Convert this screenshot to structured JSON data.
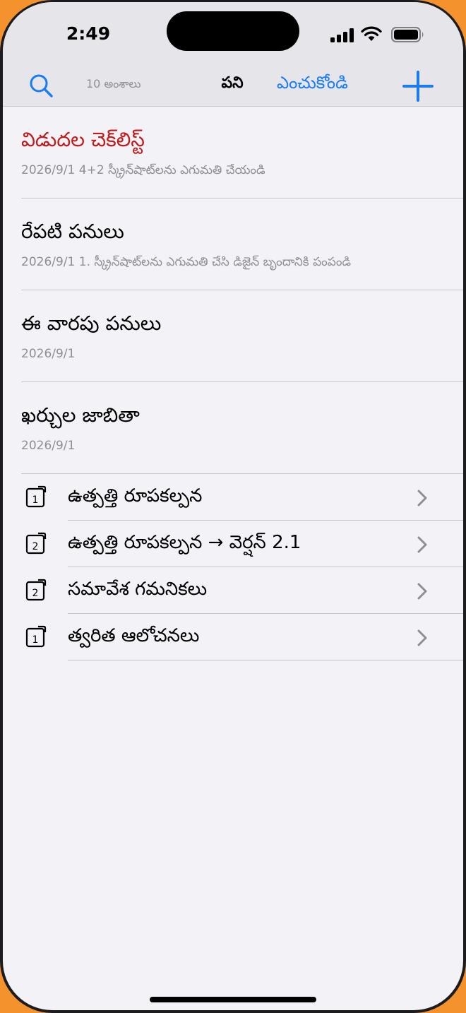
{
  "status_bar": {
    "time": "2:49"
  },
  "nav": {
    "item_count": "10 అంశాలు",
    "title": "పని",
    "select_label": "ఎంచుకోండి"
  },
  "notes": [
    {
      "title": "విడుదల చెక్‌లిస్ట్",
      "meta": "2026/9/1  4+2 స్క్రీన్‌షాట్‌లను ఎగుమతి చేయండి",
      "title_color": "#c11a1a"
    },
    {
      "title": "రేపటి పనులు",
      "meta": "2026/9/1  1. స్క్రీన్‌షాట్‌లను ఎగుమతి చేసి డిజైన్ బృందానికి పంపండి"
    },
    {
      "title": "ఈ వారపు పనులు",
      "meta": "2026/9/1"
    },
    {
      "title": "ఖర్చుల జాబితా",
      "meta": "2026/9/1"
    }
  ],
  "folders": [
    {
      "label": "ఉత్పత్తి రూపకల్పన",
      "badge": "1",
      "icon": "note-stack-icon"
    },
    {
      "label": "ఉత్పత్తి రూపకల్పన → వెర్షన్ 2.1",
      "badge": "2",
      "icon": "note-stack-icon"
    },
    {
      "label": "సమావేశ గమనికలు",
      "badge": "2",
      "icon": "note-stack-icon"
    },
    {
      "label": "త్వరిత ఆలోచనలు",
      "badge": "1",
      "icon": "note-stack-icon"
    }
  ],
  "colors": {
    "accent": "#1a7cf5",
    "background": "#f2f2f7",
    "secondary_text": "#8e8e93",
    "highlight_title": "#c11a1a"
  }
}
